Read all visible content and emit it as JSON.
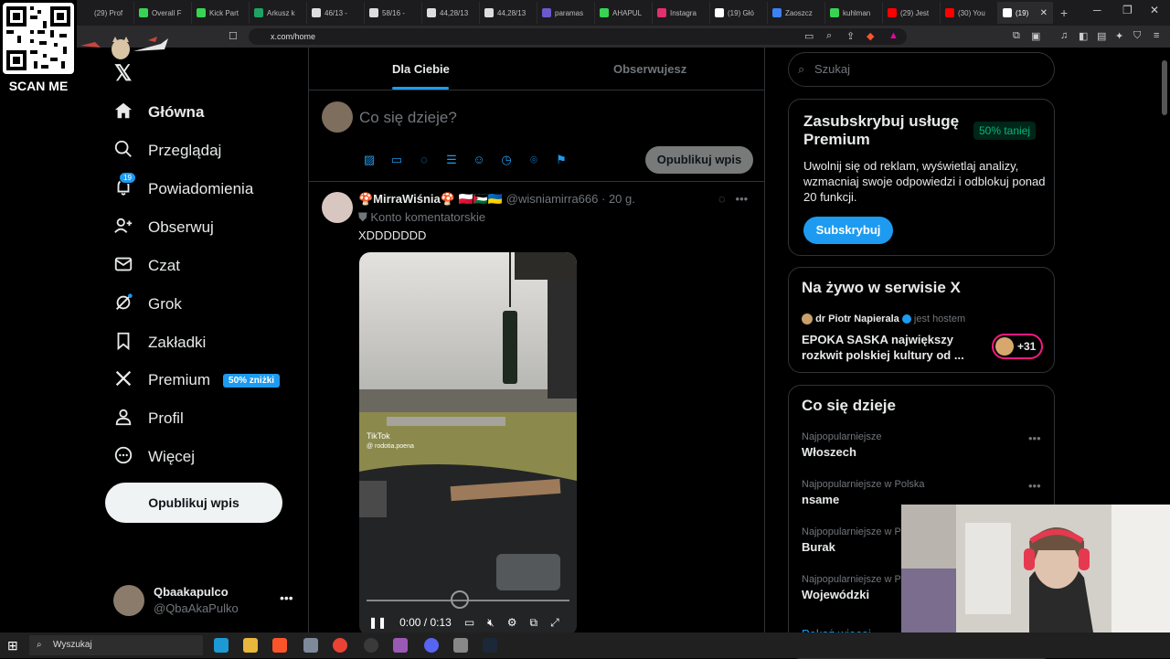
{
  "qr": {
    "label": "SCAN ME"
  },
  "browser": {
    "tabs": [
      {
        "label": "(29) Prof",
        "color": "#1c1c1e"
      },
      {
        "label": "Overall F",
        "color": "#39d353"
      },
      {
        "label": "Kick Part",
        "color": "#39d353"
      },
      {
        "label": "Arkusz k",
        "color": "#1ea362"
      },
      {
        "label": "46/13 -",
        "color": "#dddddd"
      },
      {
        "label": "58/16 -",
        "color": "#dddddd"
      },
      {
        "label": "44,28/13",
        "color": "#dddddd"
      },
      {
        "label": "44,28/13",
        "color": "#dddddd"
      },
      {
        "label": "paramas",
        "color": "#6a5acd"
      },
      {
        "label": "AHAPUL",
        "color": "#39d353"
      },
      {
        "label": "Instagra",
        "color": "#e1306c"
      },
      {
        "label": "(19) Głó",
        "color": "#ffffff"
      },
      {
        "label": "Zaoszcz",
        "color": "#3b82f6"
      },
      {
        "label": "kuhlman",
        "color": "#39d353"
      },
      {
        "label": "(29) Jest",
        "color": "#ff0000"
      },
      {
        "label": "(30) You",
        "color": "#ff0000"
      },
      {
        "label": "(19)",
        "color": "#ffffff"
      }
    ],
    "url": "x.com/home"
  },
  "nav": {
    "items": [
      {
        "label": "Główna",
        "icon": "home-icon"
      },
      {
        "label": "Przeglądaj",
        "icon": "search-icon"
      },
      {
        "label": "Powiadomienia",
        "icon": "bell-icon",
        "badge": "19"
      },
      {
        "label": "Obserwuj",
        "icon": "follow-icon"
      },
      {
        "label": "Czat",
        "icon": "mail-icon"
      },
      {
        "label": "Grok",
        "icon": "grok-icon"
      },
      {
        "label": "Zakładki",
        "icon": "bookmark-icon"
      },
      {
        "label": "Premium",
        "icon": "x-icon",
        "badge": "50% zniżki"
      },
      {
        "label": "Profil",
        "icon": "person-icon"
      },
      {
        "label": "Więcej",
        "icon": "more-icon"
      }
    ],
    "post_button": "Opublikuj wpis",
    "profile": {
      "name": "Qbaakapulco",
      "handle": "@QbaAkaPulko"
    }
  },
  "feed": {
    "tabs": [
      "Dla Ciebie",
      "Obserwujesz"
    ],
    "compose": {
      "placeholder": "Co się dzieje?",
      "button": "Opublikuj wpis"
    },
    "post": {
      "author": "🍄MirraWiśnia🍄 🇵🇱🇵🇸🇺🇦",
      "handle": "@wisniamirra666",
      "time": "20 g.",
      "sub": "Konto komentatorskie",
      "text": "XDDDDDDD",
      "video": {
        "time": "0:00 / 0:13",
        "watermark": "TikTok",
        "watermark_user": "@ rodotia.poena"
      }
    }
  },
  "sidebar": {
    "search_placeholder": "Szukaj",
    "premium": {
      "title": "Zasubskrybuj usługę Premium",
      "discount": "50% taniej",
      "body": "Uwolnij się od reklam, wyświetlaj analizy, wzmacniaj swoje odpowiedzi i odblokuj ponad 20 funkcji.",
      "button": "Subskrybuj"
    },
    "live": {
      "title": "Na żywo w serwisie X",
      "host": "dr Piotr Napierala",
      "host_suffix": "jest hostem",
      "stream_title": "EPOKA SASKA największy rozkwit polskiej kultury od ...",
      "count": "+31"
    },
    "trends": {
      "title": "Co się dzieje",
      "items": [
        {
          "context": "Najpopularniejsze",
          "name": "Włoszech"
        },
        {
          "context": "Najpopularniejsze w Polska",
          "name": "nsame"
        },
        {
          "context": "Najpopularniejsze w P",
          "name": "Burak"
        },
        {
          "context": "Najpopularniejsze w P",
          "name": "Wojewódzki"
        }
      ],
      "show_more": "Pokaż więcej"
    }
  },
  "taskbar": {
    "search": "Wyszukaj"
  }
}
